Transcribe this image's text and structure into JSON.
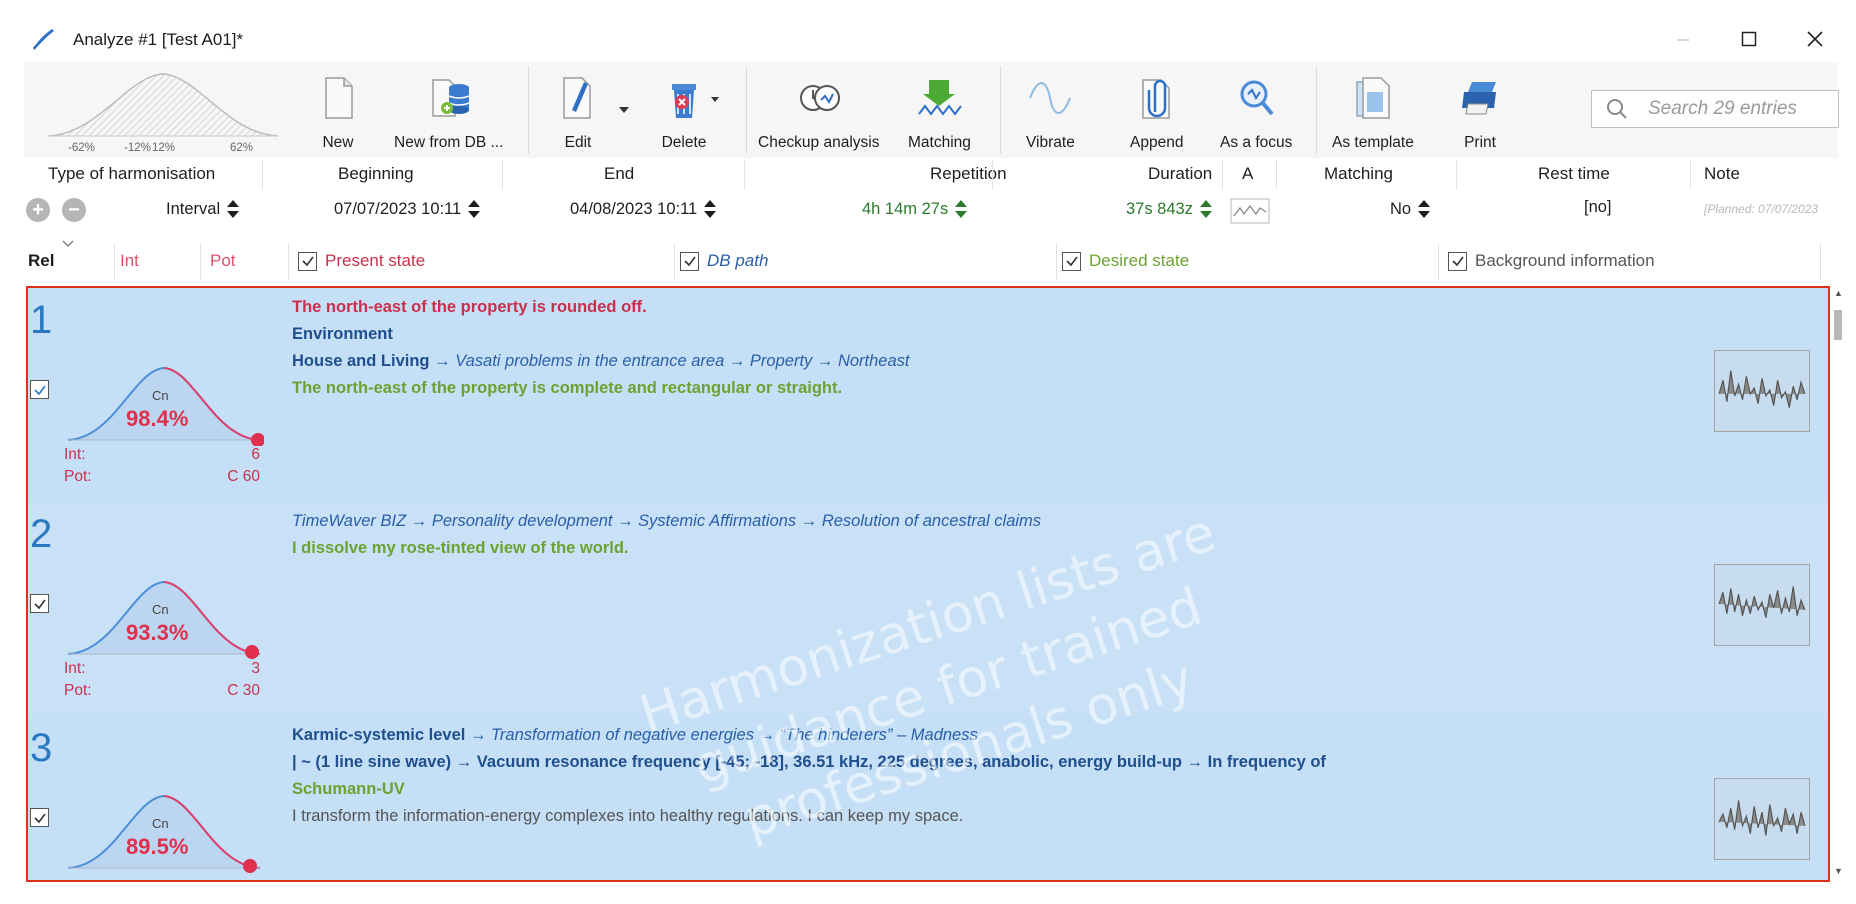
{
  "window": {
    "title": "Analyze #1 [Test A01]*"
  },
  "toolbar": {
    "curve_ticks": [
      "-62%",
      "-12%",
      "12%",
      "62%"
    ],
    "buttons": [
      {
        "id": "new",
        "label": "New"
      },
      {
        "id": "new-from-db",
        "label": "New from DB ..."
      },
      {
        "id": "edit",
        "label": "Edit"
      },
      {
        "id": "delete",
        "label": "Delete"
      },
      {
        "id": "checkup",
        "label": "Checkup analysis"
      },
      {
        "id": "matching",
        "label": "Matching"
      },
      {
        "id": "vibrate",
        "label": "Vibrate"
      },
      {
        "id": "append",
        "label": "Append"
      },
      {
        "id": "as-focus",
        "label": "As a focus"
      },
      {
        "id": "as-template",
        "label": "As template"
      },
      {
        "id": "print",
        "label": "Print"
      }
    ],
    "search_placeholder": "Search 29 entries"
  },
  "settings": {
    "headers": {
      "type": "Type of harmonisation",
      "beginning": "Beginning",
      "end": "End",
      "repetition": "Repetition",
      "duration": "Duration",
      "a": "A",
      "matching": "Matching",
      "rest": "Rest time",
      "note": "Note"
    },
    "values": {
      "type": "Interval",
      "beginning": "07/07/2023 10:11",
      "end": "04/08/2023 10:11",
      "repetition": "4h 14m 27s",
      "duration": "37s 843z",
      "matching": "No",
      "rest": "[no]",
      "note": "[Planned: 07/07/2023"
    }
  },
  "columns": {
    "rel": "Rel",
    "int": "Int",
    "pot": "Pot",
    "present": "Present state",
    "db_path": "DB path",
    "desired": "Desired state",
    "background": "Background information"
  },
  "entries": [
    {
      "number": "1",
      "percent": "98.4%",
      "cn": "Cn",
      "int_label": "Int:",
      "int_value": "6",
      "pot_label": "Pot:",
      "pot_value": "C 60",
      "present": "The north-east of the property is rounded off.",
      "category": "Environment",
      "path_head": "House and Living",
      "path_tail": "Vasati problems in the entrance area → Property → Northeast",
      "desired": "The north-east of the property is complete and rectangular or straight."
    },
    {
      "number": "2",
      "percent": "93.3%",
      "cn": "Cn",
      "int_label": "Int:",
      "int_value": "3",
      "pot_label": "Pot:",
      "pot_value": "C 30",
      "path_full": "TimeWaver BIZ → Personality development → Systemic Affirmations → Resolution of ancestral claims",
      "desired": "I dissolve my rose-tinted view of the world."
    },
    {
      "number": "3",
      "percent": "89.5%",
      "cn": "Cn",
      "path_head": "Karmic-systemic level",
      "path_tail": "Transformation of negative energies → “The hinderers” – Madness",
      "freq_line": "| ~ (1 line sine wave) → Vacuum resonance frequency [-45; -18], 36.51 kHz, 225 degrees, anabolic, energy build-up → In frequency of",
      "desired": "Schumann-UV",
      "background": "I transform the information-energy complexes into healthy regulations. I can keep my space."
    }
  ],
  "watermark": [
    "Harmonization lists are",
    "guidance for trained",
    "professionals only"
  ],
  "colors": {
    "list_bg": "#c5dff6",
    "list_border": "#e0301e",
    "present": "#c9304c",
    "db_path": "#2a5fa8",
    "desired": "#6ca232",
    "number": "#2b78c2"
  }
}
